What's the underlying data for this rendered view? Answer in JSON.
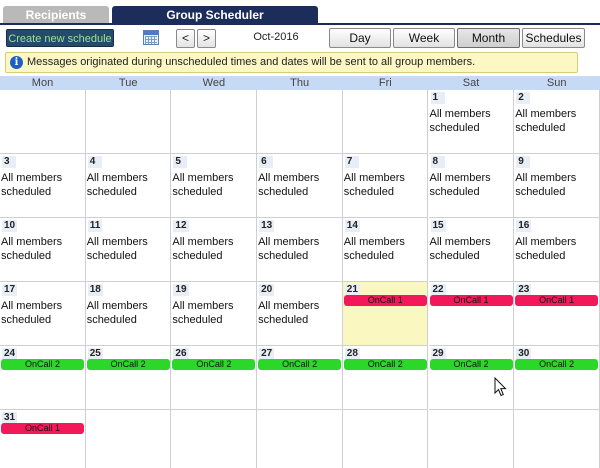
{
  "tabs": [
    {
      "label": "Recipients",
      "active": false
    },
    {
      "label": "Group Scheduler",
      "active": true
    }
  ],
  "toolbar": {
    "create_label": "Create new schedule",
    "prev_label": "<",
    "next_label": ">",
    "month_label": "Oct-2016",
    "views": [
      "Day",
      "Week",
      "Month",
      "Schedules"
    ],
    "active_view": "Month"
  },
  "info": {
    "icon": "i",
    "text": "Messages originated during unscheduled times and dates will be sent to all group members."
  },
  "calendar": {
    "days_of_week": [
      "Mon",
      "Tue",
      "Wed",
      "Thu",
      "Fri",
      "Sat",
      "Sun"
    ],
    "weeks": [
      [
        {
          "day": "",
          "text": ""
        },
        {
          "day": "",
          "text": ""
        },
        {
          "day": "",
          "text": ""
        },
        {
          "day": "",
          "text": ""
        },
        {
          "day": "",
          "text": ""
        },
        {
          "day": "1",
          "text": "All members scheduled"
        },
        {
          "day": "2",
          "text": "All members scheduled"
        }
      ],
      [
        {
          "day": "3",
          "text": "All members scheduled"
        },
        {
          "day": "4",
          "text": "All members scheduled"
        },
        {
          "day": "5",
          "text": "All members scheduled"
        },
        {
          "day": "6",
          "text": "All members scheduled"
        },
        {
          "day": "7",
          "text": "All members scheduled"
        },
        {
          "day": "8",
          "text": "All members scheduled"
        },
        {
          "day": "9",
          "text": "All members scheduled"
        }
      ],
      [
        {
          "day": "10",
          "text": "All members scheduled"
        },
        {
          "day": "11",
          "text": "All members scheduled"
        },
        {
          "day": "12",
          "text": "All members scheduled"
        },
        {
          "day": "13",
          "text": "All members scheduled"
        },
        {
          "day": "14",
          "text": "All members scheduled"
        },
        {
          "day": "15",
          "text": "All members scheduled"
        },
        {
          "day": "16",
          "text": "All members scheduled"
        }
      ],
      [
        {
          "day": "17",
          "text": "All members scheduled"
        },
        {
          "day": "18",
          "text": "All members scheduled"
        },
        {
          "day": "19",
          "text": "All members scheduled"
        },
        {
          "day": "20",
          "text": "All members scheduled"
        },
        {
          "day": "21",
          "event": "OnCall 1",
          "today": true
        },
        {
          "day": "22",
          "event": "OnCall 1"
        },
        {
          "day": "23",
          "event": "OnCall 1"
        }
      ],
      [
        {
          "day": "24",
          "event": "OnCall 2"
        },
        {
          "day": "25",
          "event": "OnCall 2"
        },
        {
          "day": "26",
          "event": "OnCall 2"
        },
        {
          "day": "27",
          "event": "OnCall 2"
        },
        {
          "day": "28",
          "event": "OnCall 2"
        },
        {
          "day": "29",
          "event": "OnCall 2"
        },
        {
          "day": "30",
          "event": "OnCall 2"
        }
      ],
      [
        {
          "day": "31",
          "event": "OnCall 1"
        },
        {
          "day": "",
          "text": ""
        },
        {
          "day": "",
          "text": ""
        },
        {
          "day": "",
          "text": ""
        },
        {
          "day": "",
          "text": ""
        },
        {
          "day": "",
          "text": ""
        },
        {
          "day": "",
          "text": ""
        }
      ]
    ]
  },
  "colors": {
    "tab_active": "#1c2d5c",
    "tab_inactive": "#b9b9b9",
    "oncall_1": "#f2185a",
    "oncall_2": "#2bd729",
    "header_bg": "#c6daf5",
    "today_bg": "#fbf7c0",
    "info_bg": "#fdf7c3"
  },
  "icons": {
    "calendar": "calendar-icon",
    "info": "info-icon",
    "cursor": "mouse-cursor-icon"
  }
}
